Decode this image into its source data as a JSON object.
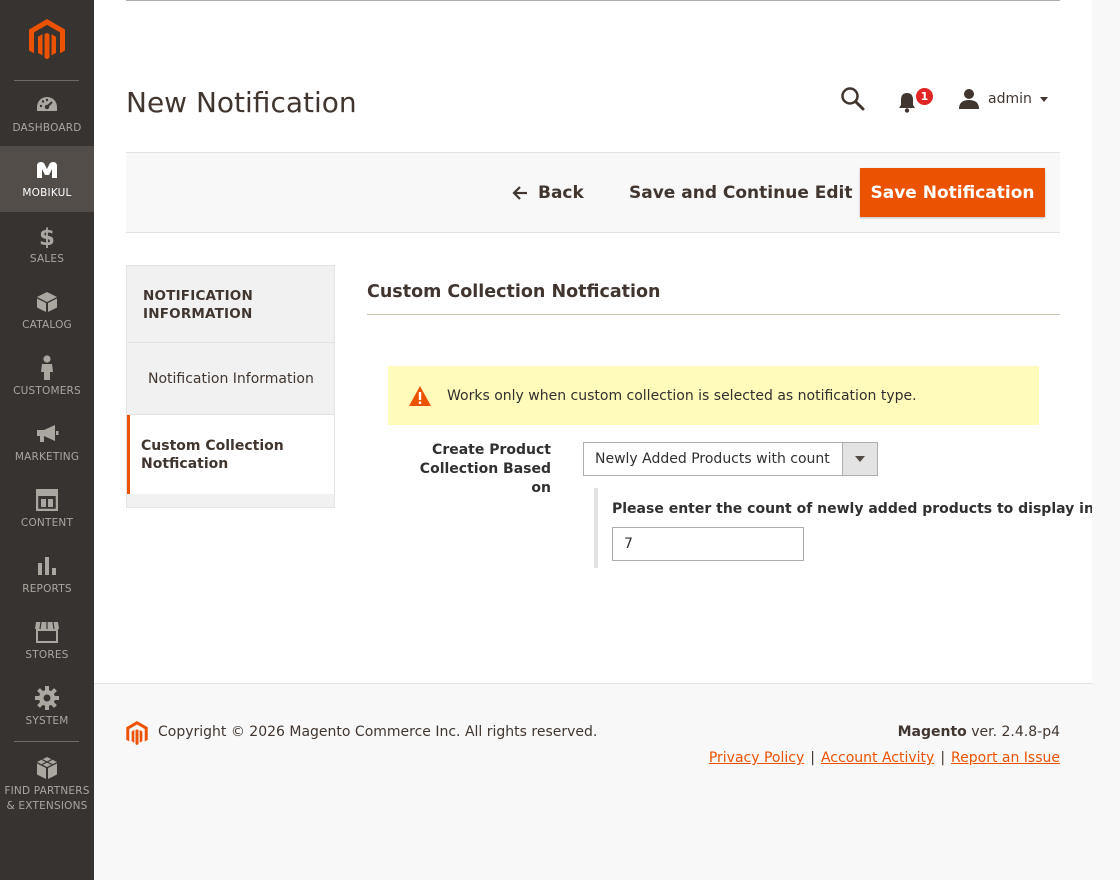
{
  "sidebar": {
    "items": [
      {
        "label": "DASHBOARD",
        "icon": "dashboard-icon"
      },
      {
        "label": "MOBIKUL",
        "icon": "mobikul-icon"
      },
      {
        "label": "SALES",
        "icon": "dollar-icon"
      },
      {
        "label": "CATALOG",
        "icon": "box-icon"
      },
      {
        "label": "CUSTOMERS",
        "icon": "person-icon"
      },
      {
        "label": "MARKETING",
        "icon": "megaphone-icon"
      },
      {
        "label": "CONTENT",
        "icon": "layout-icon"
      },
      {
        "label": "REPORTS",
        "icon": "bar-chart-icon"
      },
      {
        "label": "STORES",
        "icon": "store-icon"
      },
      {
        "label": "SYSTEM",
        "icon": "gear-icon"
      },
      {
        "label": "FIND PARTNERS & EXTENSIONS",
        "icon": "cubes-icon"
      }
    ],
    "active_index": 1
  },
  "header": {
    "title": "New Notification",
    "notification_count": "1",
    "user": "admin"
  },
  "actions": {
    "back_label": "Back",
    "save_continue_label": "Save and Continue Edit",
    "save_label": "Save Notification"
  },
  "tabs": {
    "heading": "NOTIFICATION INFORMATION",
    "items": [
      {
        "label": "Notification Information"
      },
      {
        "label": "Custom Collection Notfication"
      }
    ]
  },
  "content": {
    "section_title": "Custom Collection Notfication",
    "notice": "Works only when custom collection is selected as notification type.",
    "field_label": "Create Product Collection Based on",
    "select_value": "Newly Added Products with count",
    "count_label": "Please enter the count of newly added products to display in collection",
    "count_value": "7"
  },
  "footer": {
    "copyright": "Copyright © 2026 Magento Commerce Inc. All rights reserved.",
    "brand": "Magento",
    "version": "ver. 2.4.8-p4",
    "links": [
      "Privacy Policy",
      "Account Activity",
      "Report an Issue"
    ]
  },
  "colors": {
    "accent": "#eb5202",
    "sidebar_bg": "#373330",
    "notice_bg": "#fffbbb",
    "badge": "#e22626"
  }
}
